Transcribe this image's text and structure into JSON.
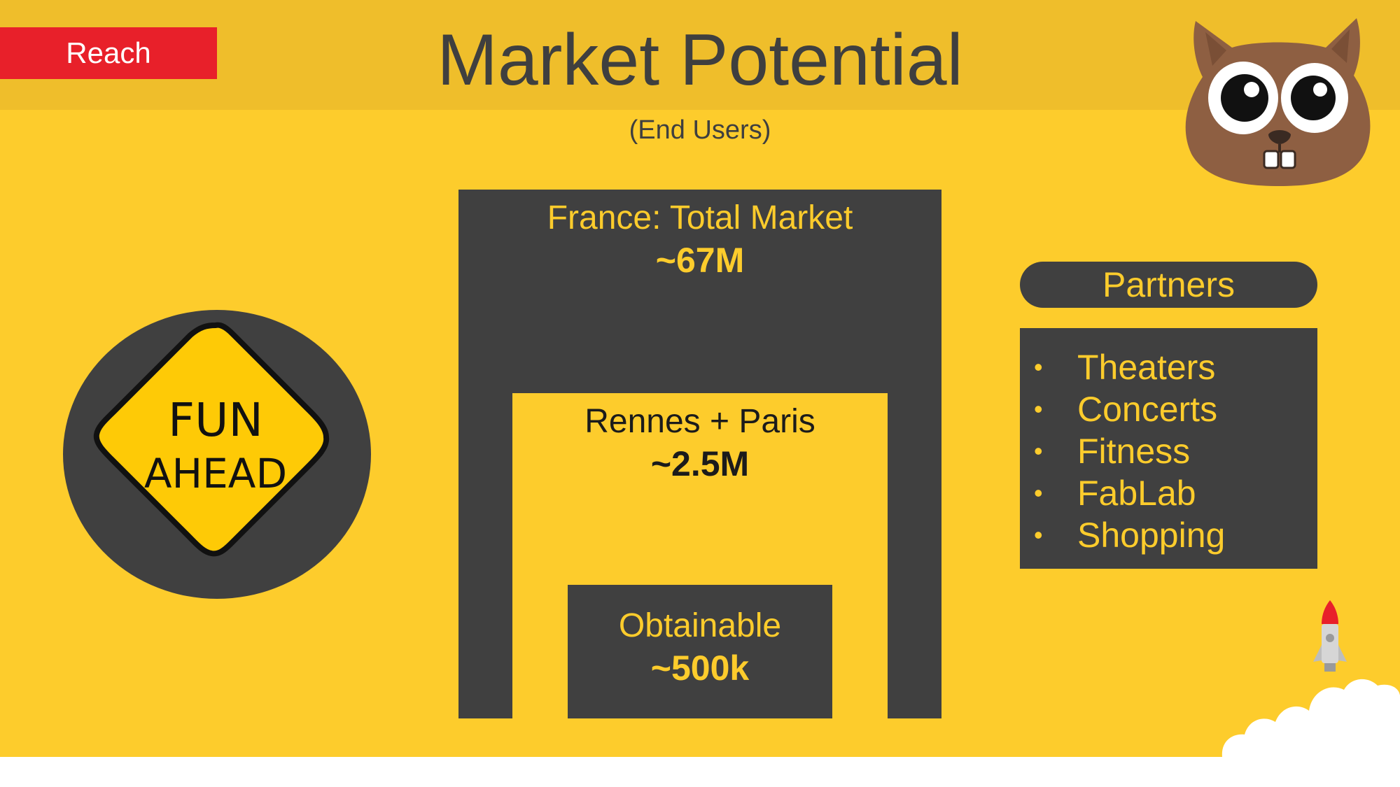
{
  "header": {
    "tag": "Reach",
    "title": "Market Potential",
    "subtitle": "(End Users)"
  },
  "sign": {
    "line1": "FUN",
    "line2": "AHEAD"
  },
  "market": {
    "total": {
      "label": "France: Total Market",
      "value": "~67M"
    },
    "serviceable": {
      "label": "Rennes + Paris",
      "value": "~2.5M"
    },
    "obtainable": {
      "label": "Obtainable",
      "value": "~500k"
    }
  },
  "partners": {
    "title": "Partners",
    "items": [
      "Theaters",
      "Concerts",
      "Fitness",
      "FabLab",
      "Shopping"
    ],
    "bullet": "•"
  },
  "colors": {
    "background": "#FDCC2C",
    "header_band": "#EFBE2B",
    "tag": "#E8202A",
    "dark": "#404040",
    "mascot": "#8E5F42"
  },
  "icons": {
    "mascot": "beaver-mascot-icon",
    "rocket": "rocket-icon",
    "sign": "fun-ahead-sign-icon"
  }
}
